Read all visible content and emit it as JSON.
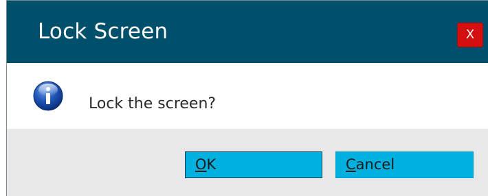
{
  "dialog": {
    "title": "Lock Screen",
    "close_label": "X",
    "message": "Lock the screen?",
    "icon": "info-icon",
    "buttons": {
      "ok": {
        "accel": "O",
        "rest": "K"
      },
      "cancel": {
        "accel": "C",
        "rest": "ancel"
      }
    }
  },
  "colors": {
    "title_bar": "#00506b",
    "close_button": "#d40f0f",
    "button": "#00b1e0",
    "footer": "#e8e8e8"
  }
}
